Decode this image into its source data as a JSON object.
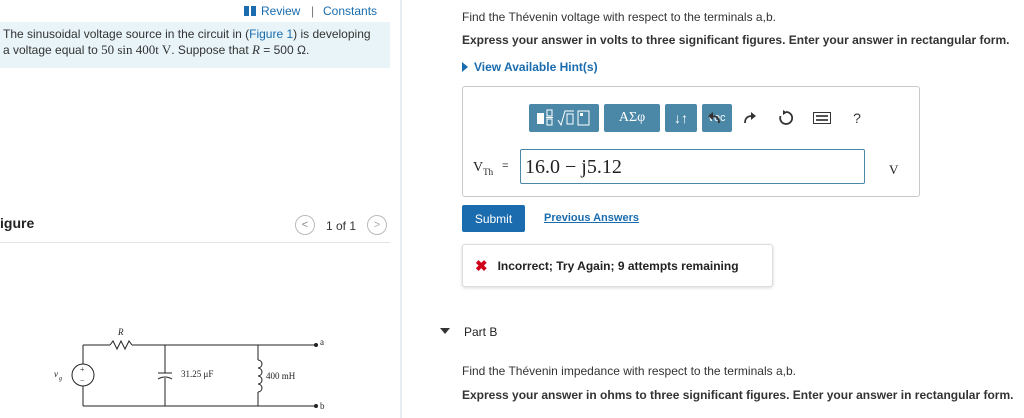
{
  "header": {
    "review_label": "Review",
    "separator": "|",
    "constants_label": "Constants"
  },
  "problem": {
    "line1_prefix": "The sinusoidal voltage source in the circuit in (",
    "figure_link": "Figure 1",
    "line1_suffix": ") is developing",
    "line2_prefix": "a voltage equal to ",
    "line2_math": "50 sin 400t V",
    "line2_mid": ". Suppose that ",
    "line2_r": "R",
    "line2_value": " = 500 Ω."
  },
  "figure": {
    "label": "igure",
    "count": "1 of 1",
    "prev_glyph": "<",
    "next_glyph": ">"
  },
  "circuit": {
    "source_label": "v",
    "source_sub": "g",
    "r_label": "R",
    "cap_label": "31.25 μF",
    "ind_label": "400 mH",
    "term_a": "a",
    "term_b": "b"
  },
  "part_a": {
    "question": "Find the Thévenin voltage with respect to the terminals a,b.",
    "instruction": "Express your answer in volts to three significant figures. Enter your answer in rectangular form.",
    "hint_label": "View Available Hint(s)",
    "toolbar": {
      "greek_label": "ΑΣφ",
      "updown_label": "↓↑",
      "vec_label": "vec",
      "help_label": "?"
    },
    "var_label": "V",
    "var_sub": "Th",
    "eq_label": "=",
    "answer_value": "16.0 − j5.12",
    "unit": "V",
    "submit_label": "Submit",
    "previous_answers_label": "Previous Answers",
    "feedback_text": "Incorrect; Try Again; 9 attempts remaining"
  },
  "part_b": {
    "title": "Part B",
    "question": "Find the Thévenin impedance with respect to the terminals a,b.",
    "instruction": "Express your answer in ohms to three significant figures. Enter your answer in rectangular form."
  },
  "colors": {
    "link": "#1a6cae",
    "toolbar": "#4b88a8",
    "error": "#d0021b",
    "problem_bg": "#e8f4f8"
  }
}
